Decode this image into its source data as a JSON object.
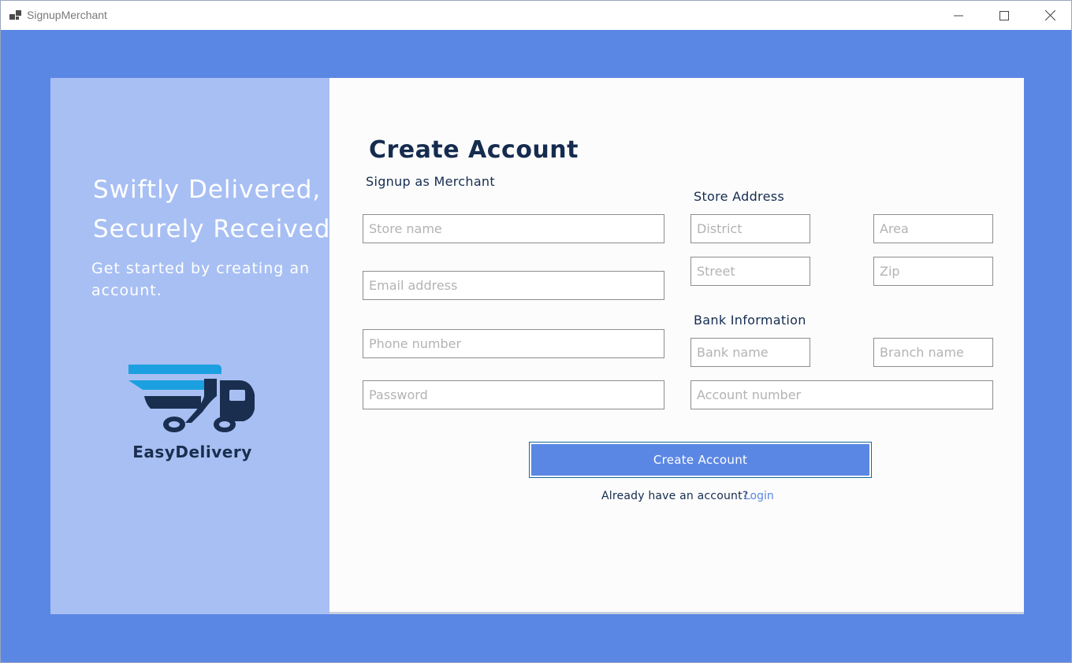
{
  "window": {
    "title": "SignupMerchant"
  },
  "left": {
    "tagline_line1": "Swiftly Delivered,",
    "tagline_line2": "Securely Received.",
    "subtitle": "Get started by creating an account.",
    "brand": "EasyDelivery"
  },
  "form": {
    "heading": "Create Account",
    "subheading": "Signup as Merchant",
    "store_address_label": "Store Address",
    "bank_info_label": "Bank Information",
    "store_name_placeholder": "Store name",
    "email_placeholder": "Email address",
    "phone_placeholder": "Phone number",
    "password_placeholder": "Password",
    "district_placeholder": "District",
    "area_placeholder": "Area",
    "street_placeholder": "Street",
    "zip_placeholder": "Zip",
    "bank_name_placeholder": "Bank name",
    "branch_name_placeholder": "Branch name",
    "account_number_placeholder": "Account number",
    "submit_label": "Create Account",
    "already_text": "Already have an account?",
    "login_label": "Login"
  },
  "colors": {
    "background": "#5b87e4",
    "left_panel": "#a8bff3",
    "heading": "#152c4f",
    "logo_light": "#1aa0e0",
    "logo_dark": "#1a2e4f"
  },
  "icons": {
    "app": "app-window-icon",
    "minimize": "minimize-icon",
    "maximize": "maximize-icon",
    "close": "close-icon",
    "logo": "delivery-truck-icon"
  }
}
